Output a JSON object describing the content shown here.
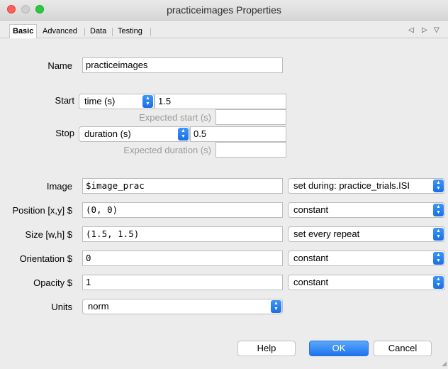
{
  "window": {
    "title": "practiceimages Properties"
  },
  "tabs": [
    "Basic",
    "Advanced",
    "Data",
    "Testing"
  ],
  "tab_nav": {
    "prev_glyph": "◁",
    "next_glyph": "▷",
    "menu_glyph": "▽"
  },
  "form": {
    "name": {
      "label": "Name",
      "value": "practiceimages"
    },
    "start": {
      "label": "Start",
      "type": "time (s)",
      "value": "1.5",
      "expected_label": "Expected start (s)",
      "expected_value": ""
    },
    "stop": {
      "label": "Stop",
      "type": "duration (s)",
      "value": "0.5",
      "expected_label": "Expected duration (s)",
      "expected_value": ""
    },
    "image": {
      "label": "Image",
      "value": "$image_prac",
      "update": "set during: practice_trials.ISI"
    },
    "position": {
      "label": "Position [x,y] $",
      "value": "(0, 0)",
      "update": "constant"
    },
    "size": {
      "label": "Size [w,h] $",
      "value": "(1.5, 1.5)",
      "update": "set every repeat"
    },
    "orientation": {
      "label": "Orientation $",
      "value": "0",
      "update": "constant"
    },
    "opacity": {
      "label": "Opacity $",
      "value": "1",
      "update": "constant"
    },
    "units": {
      "label": "Units",
      "value": "norm"
    }
  },
  "buttons": {
    "help": "Help",
    "ok": "OK",
    "cancel": "Cancel"
  },
  "colors": {
    "accent": "#1d74ee",
    "close": "#fc5f57",
    "maximize": "#2ac940"
  }
}
